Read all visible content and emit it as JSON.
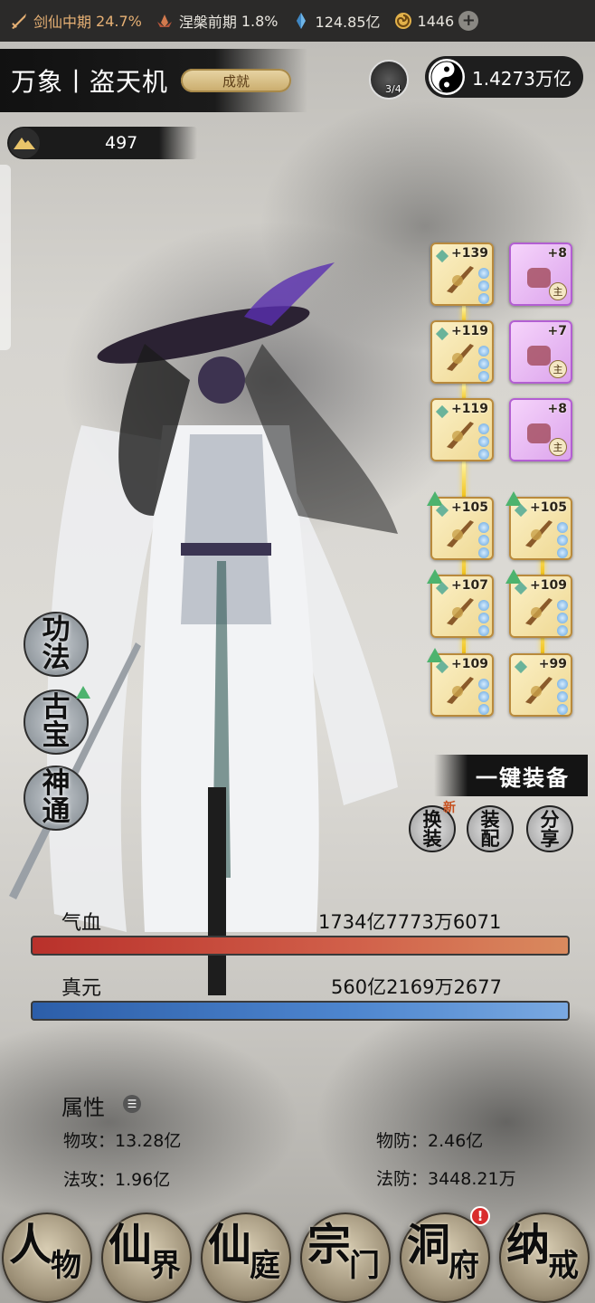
{
  "status_bar": {
    "realm_label": "剑仙中期",
    "realm_pct": "24.7%",
    "stage_label": "涅槃前期",
    "stage_pct": "1.8%",
    "spirit_stone": "124.85亿",
    "currency": "1446"
  },
  "header": {
    "title": "万象丨盗天机",
    "achievement_label": "成就",
    "energy_count": "3/4",
    "power": "1.4273万亿",
    "points": "497"
  },
  "equipment": [
    {
      "level": "+139",
      "rarity": "gold",
      "main": false
    },
    {
      "level": "+8",
      "rarity": "purple",
      "main": true
    },
    {
      "level": "+119",
      "rarity": "gold",
      "main": false
    },
    {
      "level": "+7",
      "rarity": "purple",
      "main": true
    },
    {
      "level": "+119",
      "rarity": "gold",
      "main": false
    },
    {
      "level": "+8",
      "rarity": "purple",
      "main": true
    },
    {
      "level": "+105",
      "rarity": "gold",
      "main": false
    },
    {
      "level": "+105",
      "rarity": "gold",
      "main": false
    },
    {
      "level": "+107",
      "rarity": "gold",
      "main": false
    },
    {
      "level": "+109",
      "rarity": "gold",
      "main": false
    },
    {
      "level": "+109",
      "rarity": "gold",
      "main": false
    },
    {
      "level": "+99",
      "rarity": "gold",
      "main": false
    }
  ],
  "equipment_main_badge": "主",
  "skills": {
    "gongfa": {
      "line1": "功",
      "line2": "法"
    },
    "gubao": {
      "line1": "古",
      "line2": "宝"
    },
    "shentong": {
      "line1": "神",
      "line2": "通"
    }
  },
  "actions": {
    "one_key_equip": "一键装备",
    "swap": {
      "line1": "换",
      "line2": "装",
      "badge": "新"
    },
    "assemble": {
      "line1": "装",
      "line2": "配"
    },
    "share": {
      "line1": "分",
      "line2": "享"
    }
  },
  "stats": {
    "hp_label": "气血",
    "hp_value": "1734亿7773万6071",
    "mp_label": "真元",
    "mp_value": "560亿2169万2677"
  },
  "attributes": {
    "title": "属性",
    "phys_atk": "物攻：13.28亿",
    "phys_def": "物防：2.46亿",
    "magic_atk": "法攻：1.96亿",
    "magic_def": "法防：3448.21万"
  },
  "nav": [
    {
      "big": "人",
      "small": "物"
    },
    {
      "big": "仙",
      "small": "界"
    },
    {
      "big": "仙",
      "small": "庭"
    },
    {
      "big": "宗",
      "small": "门"
    },
    {
      "big": "洞",
      "small": "府"
    },
    {
      "big": "纳",
      "small": "戒"
    }
  ],
  "nav_alert": "!",
  "colors": {
    "accent": "#e6b074",
    "hp": "#b9312b",
    "mp": "#2c5ea9",
    "purple_slot": "#b35fd2",
    "gold_slot": "#b98a3c"
  }
}
